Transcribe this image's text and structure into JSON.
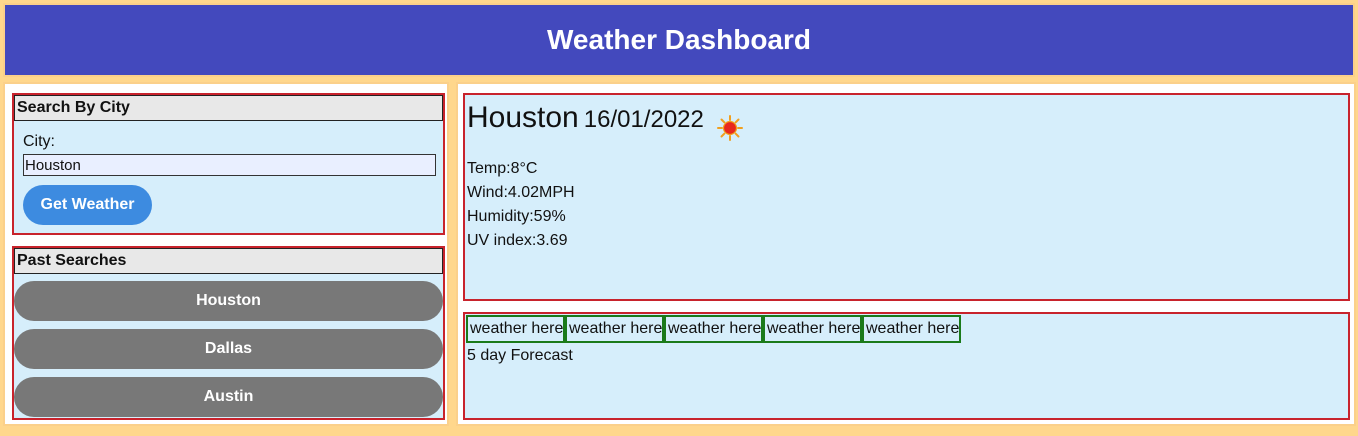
{
  "header": {
    "title": "Weather Dashboard"
  },
  "search": {
    "title": "Search By City",
    "city_label": "City:",
    "input_value": "Houston",
    "button_label": "Get Weather"
  },
  "past": {
    "title": "Past Searches",
    "items": [
      {
        "label": "Houston"
      },
      {
        "label": "Dallas"
      },
      {
        "label": "Austin"
      }
    ]
  },
  "current": {
    "city": "Houston",
    "date": "16/01/2022",
    "icon": "sun-icon",
    "temp": "Temp:8°C",
    "wind": "Wind:4.02MPH",
    "humidity": "Humidity:59%",
    "uv": "UV index:3.69"
  },
  "forecast": {
    "cards": [
      {
        "text": "weather here"
      },
      {
        "text": "weather here"
      },
      {
        "text": "weather here"
      },
      {
        "text": "weather here"
      },
      {
        "text": "weather here"
      }
    ],
    "label": "5 day Forecast"
  },
  "colors": {
    "header_bg": "#4349bd",
    "page_bg": "#ffd78c",
    "panel_bg": "#d6eefb",
    "panel_border": "#c8232c",
    "card_border": "#1a7a1a",
    "primary_button": "#3d8be0",
    "past_button": "#787878"
  }
}
